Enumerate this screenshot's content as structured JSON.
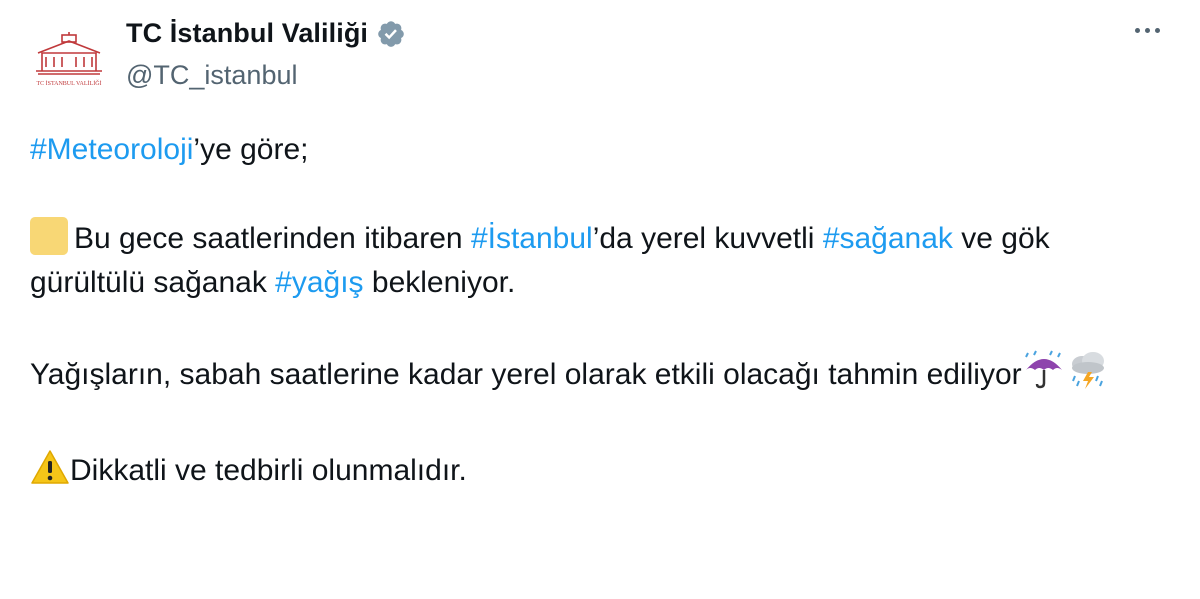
{
  "author": {
    "display_name": "TC İstanbul Valiliği",
    "handle": "@TC_istanbul",
    "avatar_caption": "TC İSTANBUL VALİLİĞİ",
    "verified": true,
    "verified_color": "#829aab"
  },
  "tweet": {
    "line1": {
      "hashtag": "#Meteoroloji",
      "text": "’ye göre;"
    },
    "para2": {
      "emoji": "yellow-square",
      "t1": "Bu gece saatlerinden itibaren ",
      "tag1": "#İstanbul",
      "t2": "’da yerel kuvvetli ",
      "tag2": "#sağanak",
      "t3": " ve gök gürültülü sağanak ",
      "tag3": "#yağış",
      "t4": " bekleniyor."
    },
    "para3": {
      "text": "Yağışların, sabah saatlerine kadar yerel olarak etkili olacağı tahmin ediliyor",
      "emojis": [
        "umbrella-with-rain-icon",
        "cloud-with-lightning-and-rain-icon"
      ]
    },
    "para4": {
      "emoji": "warning-icon",
      "text": "Dikkatli ve tedbirli olunmalıdır."
    }
  },
  "colors": {
    "link": "#1d9bf0",
    "text": "#0f1419",
    "secondary": "#536471"
  }
}
